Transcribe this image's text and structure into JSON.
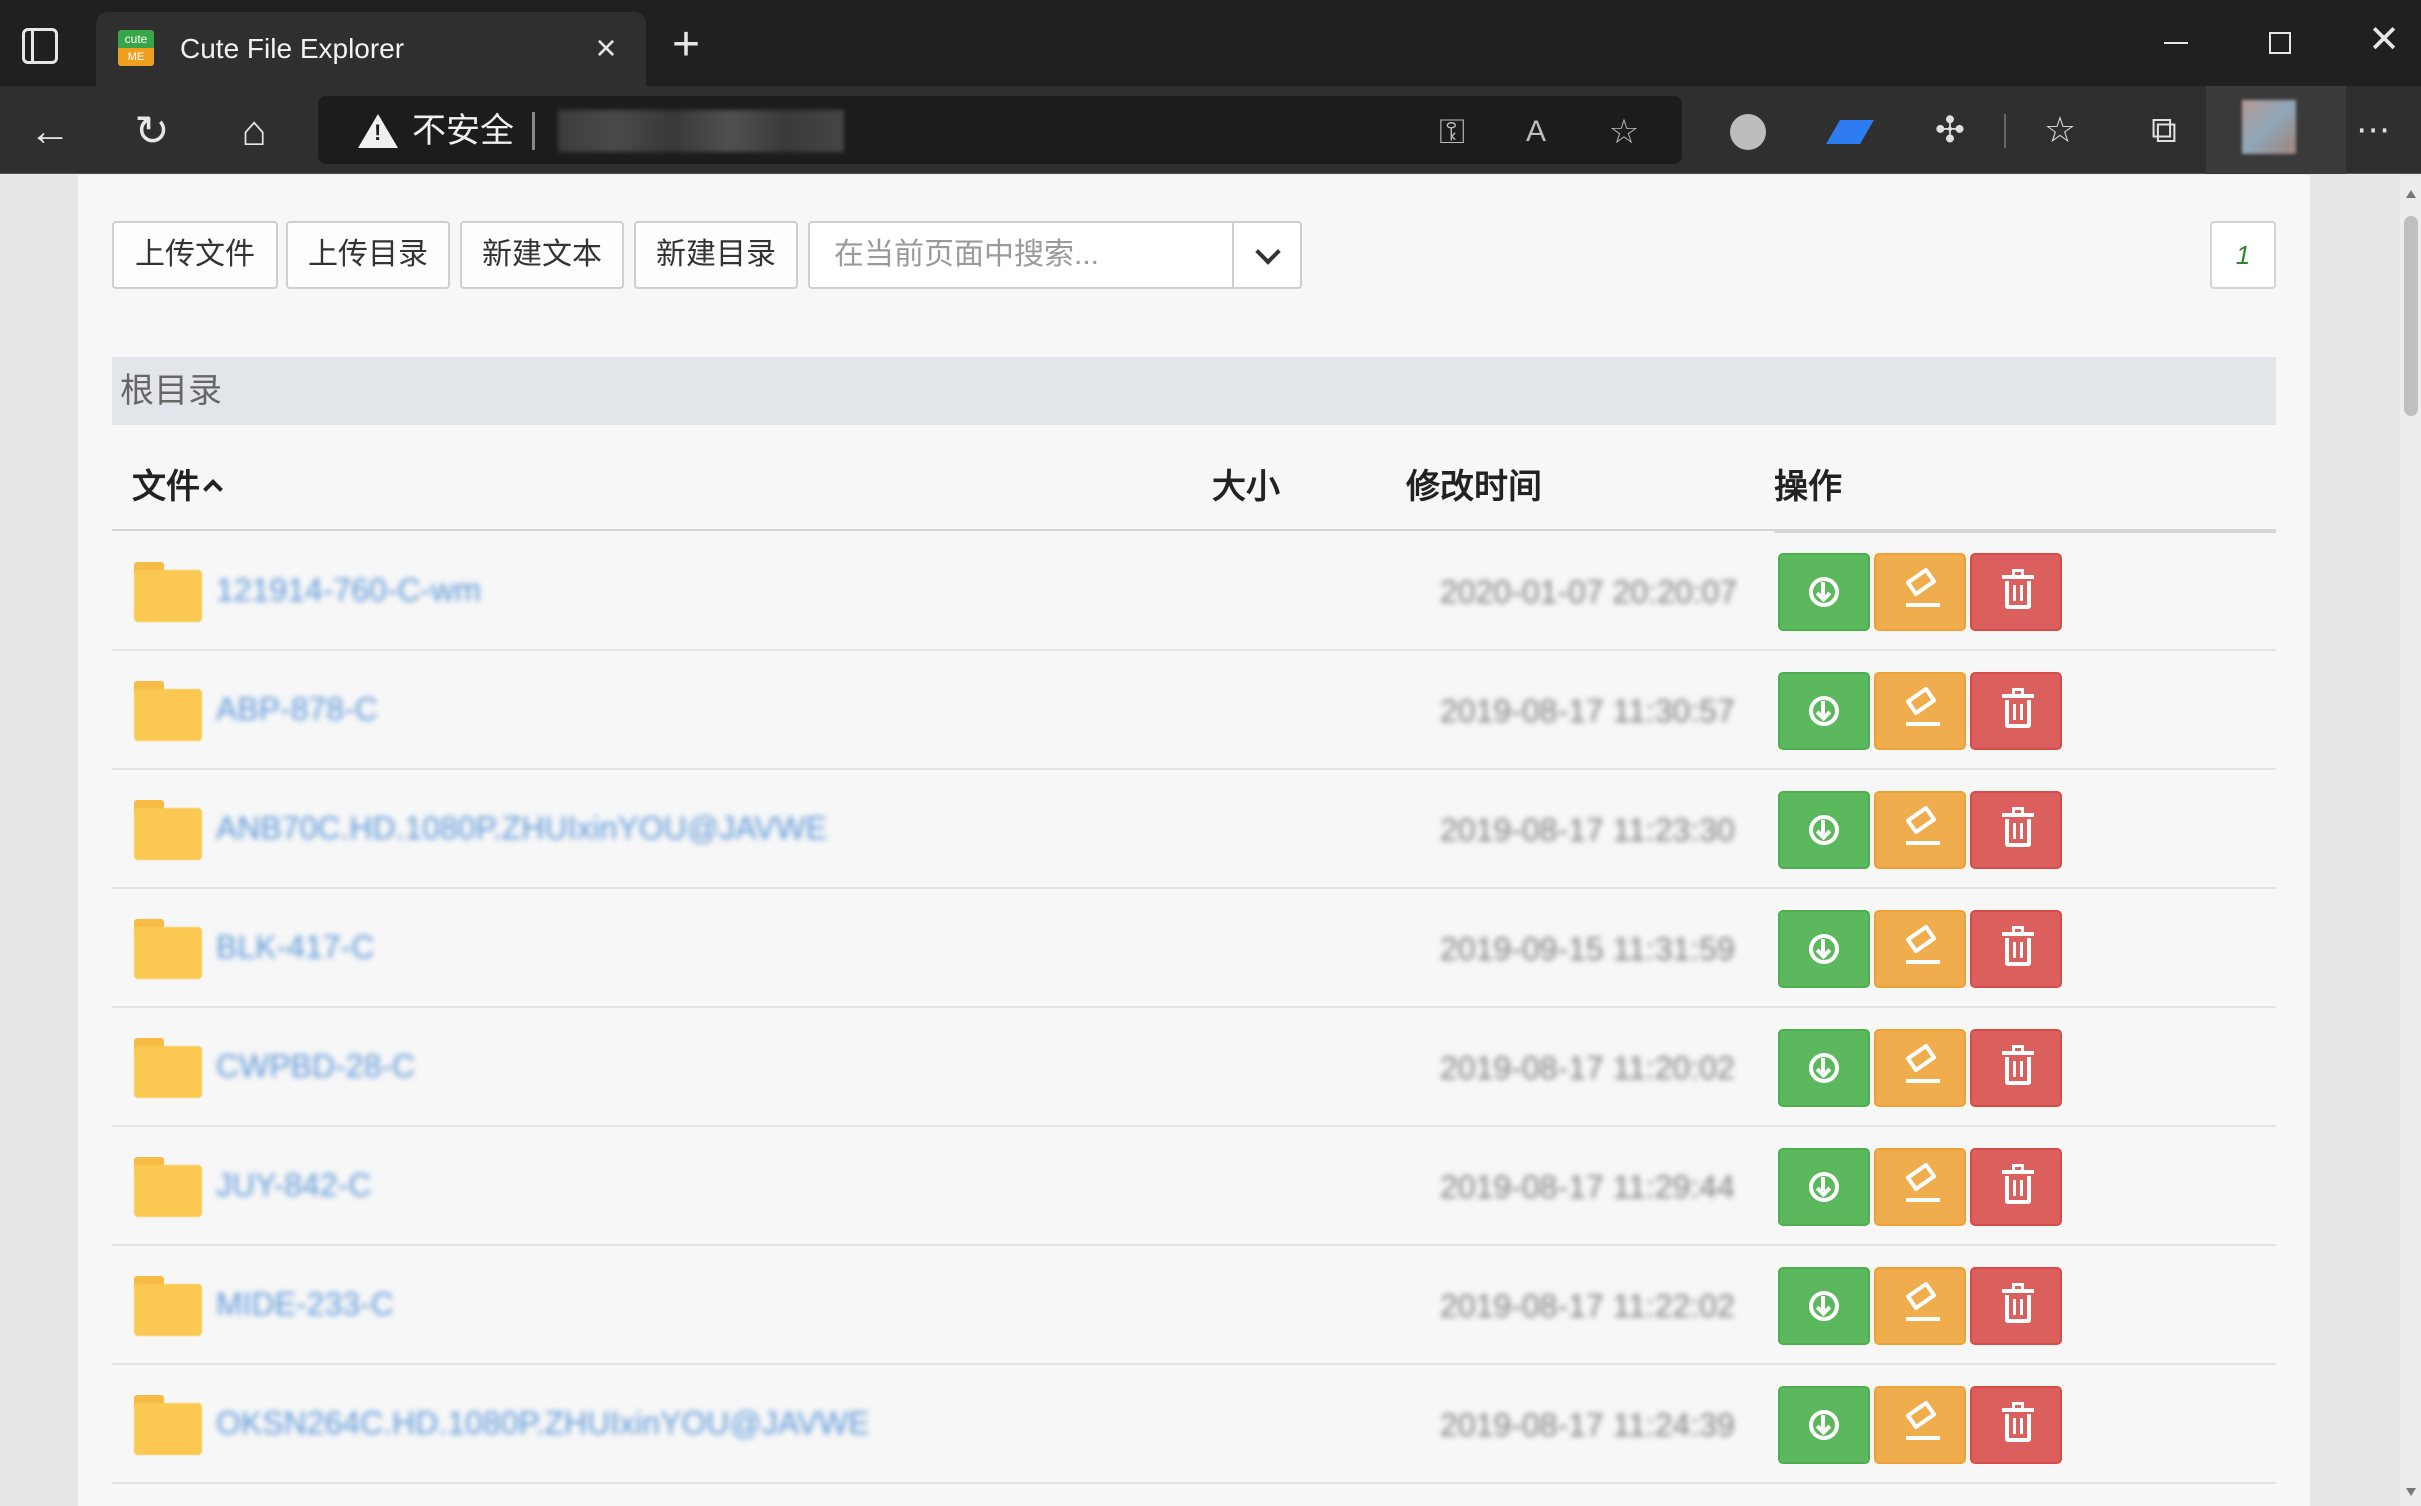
{
  "browser": {
    "tab_title": "Cute File Explorer",
    "favicon_top": "cute",
    "favicon_bottom": "ME",
    "security_label": "不安全",
    "icons": [
      "sidebar-toggle-icon",
      "close-icon",
      "plus-icon",
      "minimize-icon",
      "maximize-icon",
      "back-icon",
      "refresh-icon",
      "home-icon",
      "warning-icon",
      "key-icon",
      "read-aloud-icon",
      "add-favorite-icon",
      "performance-icon",
      "extension-icon",
      "puzzle-icon",
      "favorites-icon",
      "collections-icon",
      "more-icon"
    ]
  },
  "toolbar": {
    "upload_file": "上传文件",
    "upload_dir": "上传目录",
    "new_text": "新建文本",
    "new_dir": "新建目录",
    "search_placeholder": "在当前页面中搜索...",
    "page_number": "1"
  },
  "breadcrumb": "根目录",
  "table": {
    "headers": {
      "file": "文件",
      "size": "大小",
      "modified": "修改时间",
      "actions": "操作"
    },
    "rows": [
      {
        "name": "121914-760-C-wm",
        "size": "",
        "modified": "2020-01-07 20:20:07"
      },
      {
        "name": "ABP-878-C",
        "size": "",
        "modified": "2019-08-17 11:30:57"
      },
      {
        "name": "ANB70C.HD.1080P.ZHUIxinYOU@JAVWE",
        "size": "",
        "modified": "2019-08-17 11:23:30"
      },
      {
        "name": "BLK-417-C",
        "size": "",
        "modified": "2019-09-15 11:31:59"
      },
      {
        "name": "CWPBD-28-C",
        "size": "",
        "modified": "2019-08-17 11:20:02"
      },
      {
        "name": "JUY-842-C",
        "size": "",
        "modified": "2019-08-17 11:29:44"
      },
      {
        "name": "MIDE-233-C",
        "size": "",
        "modified": "2019-08-17 11:22:02"
      },
      {
        "name": "OKSN264C.HD.1080P.ZHUIxinYOU@JAVWE",
        "size": "",
        "modified": "2019-08-17 11:24:39"
      }
    ]
  },
  "colors": {
    "download": "#5cb85c",
    "rename": "#f0ad4e",
    "delete": "#d9534f",
    "folder": "#fbc952",
    "link": "#5b97d9",
    "breadcrumb_bg": "#e2e5e9"
  }
}
